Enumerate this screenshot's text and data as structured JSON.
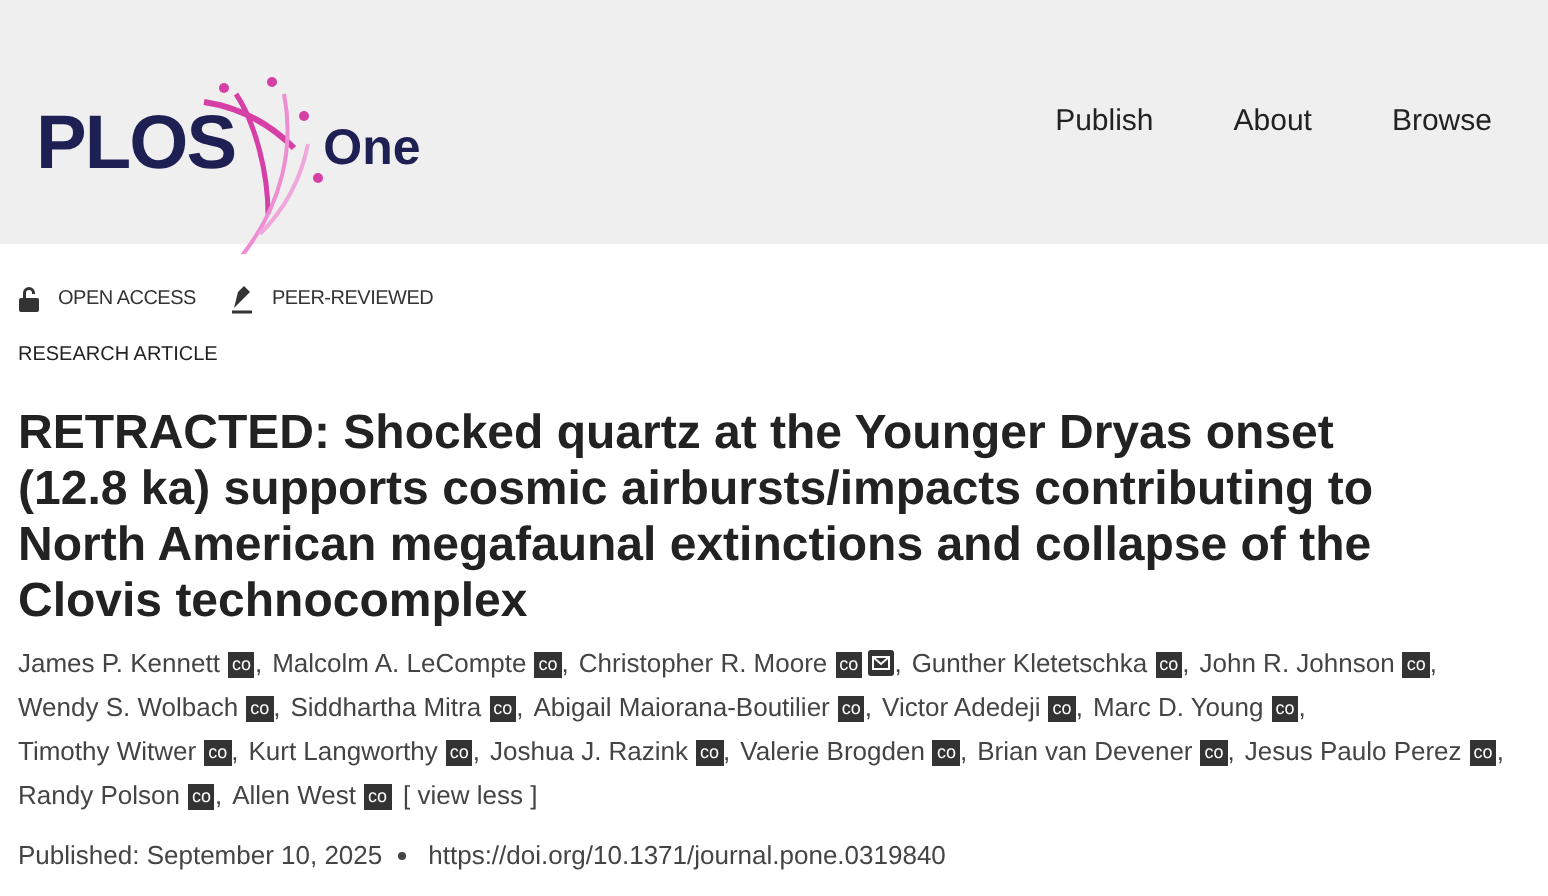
{
  "header": {
    "logo": {
      "brand": "PLOS",
      "journal": "One"
    },
    "nav": [
      "Publish",
      "About",
      "Browse"
    ]
  },
  "badges": [
    {
      "kind": "open",
      "label": "OPEN ACCESS"
    },
    {
      "kind": "peer",
      "label": "PEER-REVIEWED"
    }
  ],
  "article_type": "RESEARCH ARTICLE",
  "title": "RETRACTED: Shocked quartz at the Younger Dryas onset (12.8 ka) supports cosmic airbursts/impacts contributing to North American megafaunal extinctions and collapse of the Clovis technocomplex",
  "author_lines": [
    [
      {
        "name": "James P. Kennett",
        "links": [
          {
            "kind": "orcid",
            "text": "co"
          }
        ],
        "sep": ","
      },
      {
        "name": "Malcolm A. LeCompte",
        "links": [
          {
            "kind": "orcid",
            "text": "co"
          }
        ],
        "sep": ","
      },
      {
        "name": "Christopher R. Moore",
        "links": [
          {
            "kind": "orcid",
            "text": "co"
          },
          {
            "kind": "email"
          }
        ],
        "sep": ","
      },
      {
        "name": "Gunther Kletetschka",
        "links": [
          {
            "kind": "orcid",
            "text": "co"
          }
        ],
        "sep": ","
      },
      {
        "name": "John R. Johnson",
        "links": [
          {
            "kind": "orcid",
            "text": "co"
          }
        ],
        "sep": ","
      }
    ],
    [
      {
        "name": "Wendy S. Wolbach",
        "links": [
          {
            "kind": "orcid",
            "text": "co"
          }
        ],
        "sep": ","
      },
      {
        "name": "Siddhartha Mitra",
        "links": [
          {
            "kind": "orcid",
            "text": "co"
          }
        ],
        "sep": ","
      },
      {
        "name": "Abigail Maiorana-Boutilier",
        "links": [
          {
            "kind": "orcid",
            "text": "co"
          }
        ],
        "sep": ","
      },
      {
        "name": "Victor Adedeji",
        "links": [
          {
            "kind": "orcid",
            "text": "co"
          }
        ],
        "sep": ","
      },
      {
        "name": "Marc D. Young",
        "links": [
          {
            "kind": "orcid",
            "text": "co"
          }
        ],
        "sep": ","
      }
    ],
    [
      {
        "name": "Timothy Witwer",
        "links": [
          {
            "kind": "orcid",
            "text": "co"
          }
        ],
        "sep": ","
      },
      {
        "name": "Kurt Langworthy",
        "links": [
          {
            "kind": "orcid",
            "text": "co"
          }
        ],
        "sep": ","
      },
      {
        "name": "Joshua J. Razink",
        "links": [
          {
            "kind": "orcid",
            "text": "co"
          }
        ],
        "sep": ","
      },
      {
        "name": "Valerie Brogden",
        "links": [
          {
            "kind": "orcid",
            "text": "co"
          }
        ],
        "sep": ","
      },
      {
        "name": "Brian van Devener",
        "links": [
          {
            "kind": "orcid",
            "text": "co"
          }
        ],
        "sep": ","
      },
      {
        "name": "Jesus Paulo Perez",
        "links": [
          {
            "kind": "orcid",
            "text": "co"
          }
        ],
        "sep": ","
      }
    ],
    [
      {
        "name": "Randy Polson",
        "links": [
          {
            "kind": "orcid",
            "text": "co"
          }
        ],
        "sep": ","
      },
      {
        "name": "Allen West",
        "links": [
          {
            "kind": "orcid",
            "text": "co"
          }
        ]
      }
    ]
  ],
  "view_toggle": "[ view less ]",
  "published": "Published: September 10, 2025",
  "doi": "https://doi.org/10.1371/journal.pone.0319840"
}
